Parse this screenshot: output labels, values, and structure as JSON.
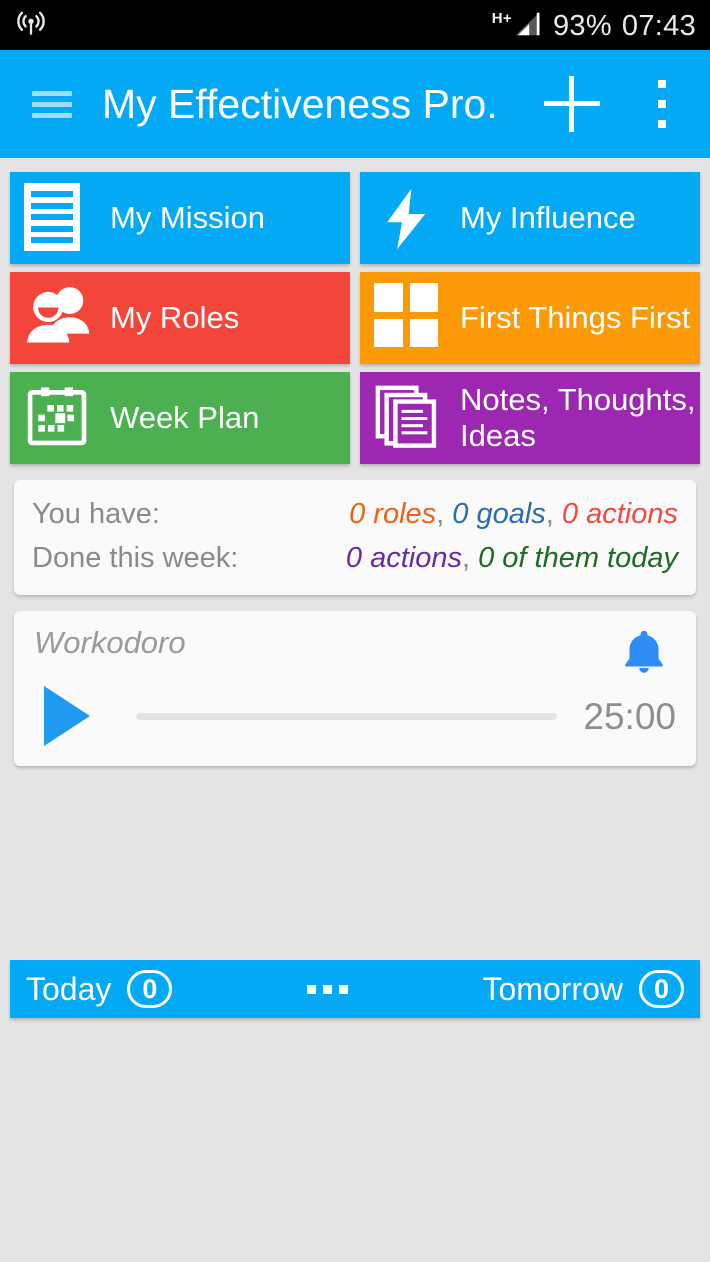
{
  "status_bar": {
    "left_icon": "broadcast-tower-icon",
    "network_type": "H+",
    "battery": "93%",
    "time": "07:43"
  },
  "app_bar": {
    "menu_icon": "hamburger-menu-icon",
    "title": "My Effectiveness Pro.",
    "add_icon": "plus-icon",
    "overflow_icon": "overflow-menu-icon"
  },
  "tiles": [
    {
      "label": "My Mission",
      "icon": "document-lines-icon",
      "color": "#03a9f4"
    },
    {
      "label": "My Influence",
      "icon": "lightning-bolt-icon",
      "color": "#03a9f4"
    },
    {
      "label": "My Roles",
      "icon": "people-group-icon",
      "color": "#f4453a"
    },
    {
      "label": "First Things First",
      "icon": "four-quadrants-icon",
      "color": "#fb9a06"
    },
    {
      "label": "Week Plan",
      "icon": "calendar-icon",
      "color": "#4caf50"
    },
    {
      "label": "Notes, Thoughts, Ideas",
      "icon": "stacked-notes-icon",
      "color": "#9c27b0"
    }
  ],
  "stats": {
    "have_label": "You have:",
    "have_values": [
      {
        "text": "0 roles",
        "color": "#ef6119"
      },
      {
        "text": "0 goals",
        "color": "#2a6db0"
      },
      {
        "text": "0 actions",
        "color": "#f4493c"
      }
    ],
    "done_label": "Done this week:",
    "done_values": [
      {
        "text": "0 actions",
        "color": "#6a2b9e"
      },
      {
        "text": "0 of them today",
        "color": "#1d6b26"
      }
    ],
    "separator": ","
  },
  "workodoro": {
    "title": "Workodoro",
    "bell_icon": "bell-icon",
    "play_icon": "play-icon",
    "progress_percent": 0,
    "time": "25:00"
  },
  "bottom_bar": {
    "today_label": "Today",
    "today_count": "0",
    "middle_icon": "three-dots-icon",
    "tomorrow_label": "Tomorrow",
    "tomorrow_count": "0"
  }
}
